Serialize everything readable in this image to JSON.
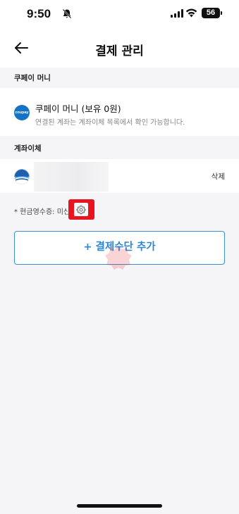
{
  "status_bar": {
    "time": "9:50",
    "battery": "56"
  },
  "header": {
    "title": "결제 관리"
  },
  "coupay_section": {
    "heading": "쿠페이 머니",
    "logo_text": "coupay",
    "title": "쿠페이 머니 (보유 0원)",
    "description": "연결된 계좌는 계좌이체 목록에서 확인 가능합니다."
  },
  "bank_section": {
    "heading": "계좌이체",
    "delete_label": "삭제"
  },
  "receipt": {
    "text": "* 현금영수증: 미신"
  },
  "add_button": {
    "label": "+ 결제수단 추가"
  },
  "colors": {
    "accent": "#2b87d4",
    "highlight": "#e8141f",
    "coupay_blue": "#1672c4"
  },
  "icons": [
    "bell-off-icon",
    "cellular-signal-icon",
    "wifi-icon",
    "battery-icon",
    "back-arrow-icon",
    "gear-icon"
  ]
}
